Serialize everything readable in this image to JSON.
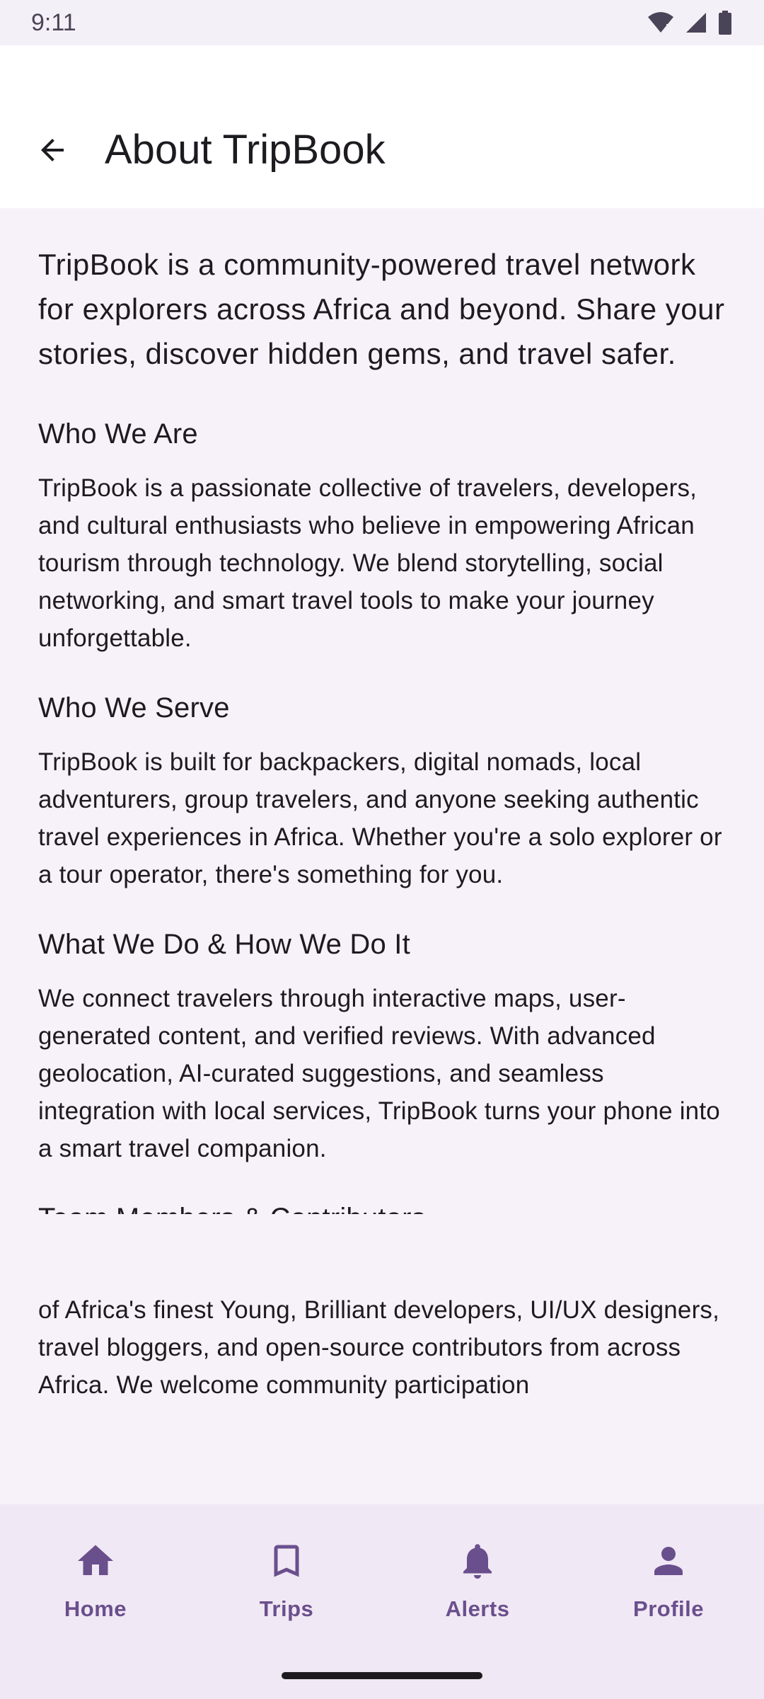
{
  "status_bar": {
    "time": "9:11"
  },
  "app_bar": {
    "title": "About TripBook",
    "back_icon": "arrow-back-icon"
  },
  "intro": "TripBook is a community-powered travel network for explorers across Africa and beyond. Share your stories, discover hidden gems, and travel safer.",
  "sections": [
    {
      "title": "Who We Are",
      "body": "TripBook is a passionate collective of travelers, developers, and cultural enthusiasts who believe in empowering African tourism through technology. We blend storytelling, social networking, and smart travel tools to make your journey unforgettable."
    },
    {
      "title": "Who We Serve",
      "body": "TripBook is built for backpackers, digital nomads, local adventurers, group travelers, and anyone seeking authentic travel experiences in Africa. Whether you're a solo explorer or a tour operator, there's something for you."
    },
    {
      "title": "What We Do & How We Do It",
      "body": "We connect travelers through interactive maps, user-generated content, and verified reviews. With advanced geolocation, AI-curated suggestions, and seamless integration with local services, TripBook turns your phone into a smart travel companion."
    },
    {
      "title": "Team Members & Contributors",
      "body": "TripBook was born and brought to light by a dedicated team of Africa's finest Young, Brilliant developers, UI/UX designers, travel bloggers, and open-source contributors from across Africa. We welcome community participation"
    }
  ],
  "bottom_nav": {
    "items": [
      {
        "label": "Home",
        "icon": "home-icon"
      },
      {
        "label": "Trips",
        "icon": "bookmark-icon"
      },
      {
        "label": "Alerts",
        "icon": "bell-icon"
      },
      {
        "label": "Profile",
        "icon": "person-icon"
      }
    ]
  },
  "colors": {
    "accent": "#6a4f8d",
    "background": "#f7f2fa",
    "nav_background": "#f0e8f4",
    "text": "#1d1b20"
  }
}
